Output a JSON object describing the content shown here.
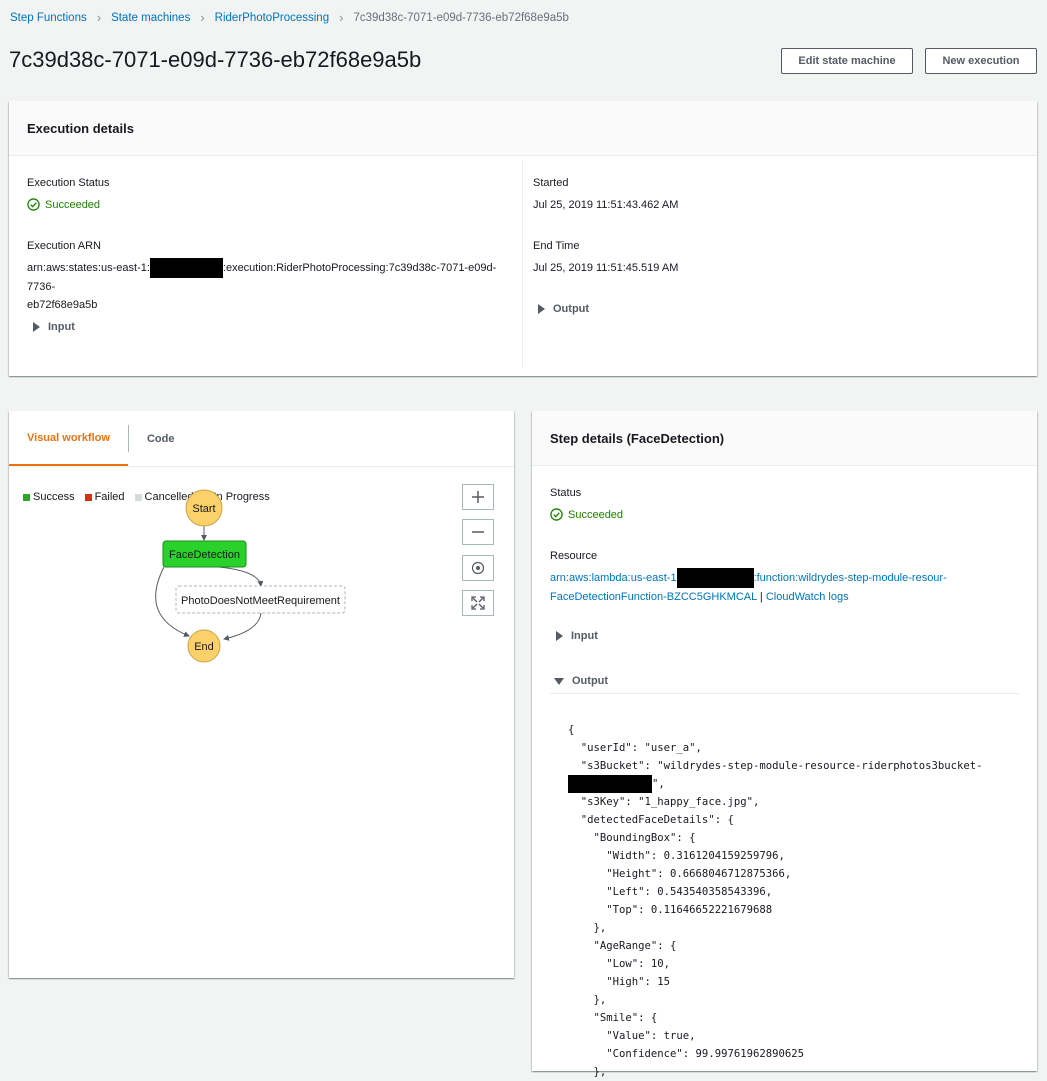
{
  "breadcrumb": [
    "Step Functions",
    "State machines",
    "RiderPhotoProcessing",
    "7c39d38c-7071-e09d-7736-eb72f68e9a5b"
  ],
  "page_title": "7c39d38c-7071-e09d-7736-eb72f68e9a5b",
  "buttons": {
    "edit": "Edit state machine",
    "new_execution": "New execution"
  },
  "execution_details": {
    "title": "Execution details",
    "status_label": "Execution Status",
    "status_value": "Succeeded",
    "arn_label": "Execution ARN",
    "arn_prefix": "arn:aws:states:us-east-1:",
    "arn_suffix": ":execution:RiderPhotoProcessing:7c39d38c-7071-e09d-7736-",
    "arn_line2": "eb72f68e9a5b",
    "input_label": "Input",
    "started_label": "Started",
    "started_value": "Jul 25, 2019 11:51:43.462 AM",
    "end_label": "End Time",
    "end_value": "Jul 25, 2019 11:51:45.519 AM",
    "output_label": "Output"
  },
  "workflow": {
    "tabs": [
      "Visual workflow",
      "Code"
    ],
    "legend": [
      "Success",
      "Failed",
      "Cancelled",
      "In Progress"
    ],
    "legend_colors": [
      "#2ea52e",
      "#d13212",
      "#d5dbdb",
      "#44b9d6"
    ],
    "nodes": {
      "start": "Start",
      "face": "FaceDetection",
      "photo": "PhotoDoesNotMeetRequirement",
      "end": "End"
    },
    "controls": [
      "zoom-in",
      "zoom-out",
      "center",
      "fit"
    ]
  },
  "step_details": {
    "title": "Step details (FaceDetection)",
    "status_label": "Status",
    "status_value": "Succeeded",
    "resource_label": "Resource",
    "resource_prefix": "arn:aws:lambda:us-east-1",
    "resource_suffix": ":function:wildrydes-step-module-resour-",
    "resource_line2": "FaceDetectionFunction-BZCC5GHKMCAL",
    "separator": "|",
    "cloudwatch": "CloudWatch logs",
    "input_label": "Input",
    "output_label": "Output",
    "output_json": "{\n  \"userId\": \"user_a\",\n  \"s3Bucket\": \"wildrydes-step-module-resource-riderphotos3bucket-\n",
    "output_json_after_redact": "\",\n  \"s3Key\": \"1_happy_face.jpg\",\n  \"detectedFaceDetails\": {\n    \"BoundingBox\": {\n      \"Width\": 0.3161204159259796,\n      \"Height\": 0.6668046712875366,\n      \"Left\": 0.543540358543396,\n      \"Top\": 0.11646652221679688\n    },\n    \"AgeRange\": {\n      \"Low\": 10,\n      \"High\": 15\n    },\n    \"Smile\": {\n      \"Value\": true,\n      \"Confidence\": 99.99761962890625\n    },"
  },
  "colors": {
    "link": "#0073bb",
    "success": "#1d8102",
    "accent": "#ec7211",
    "node_green": "#2bd12b",
    "node_yellow": "#fcd169"
  }
}
